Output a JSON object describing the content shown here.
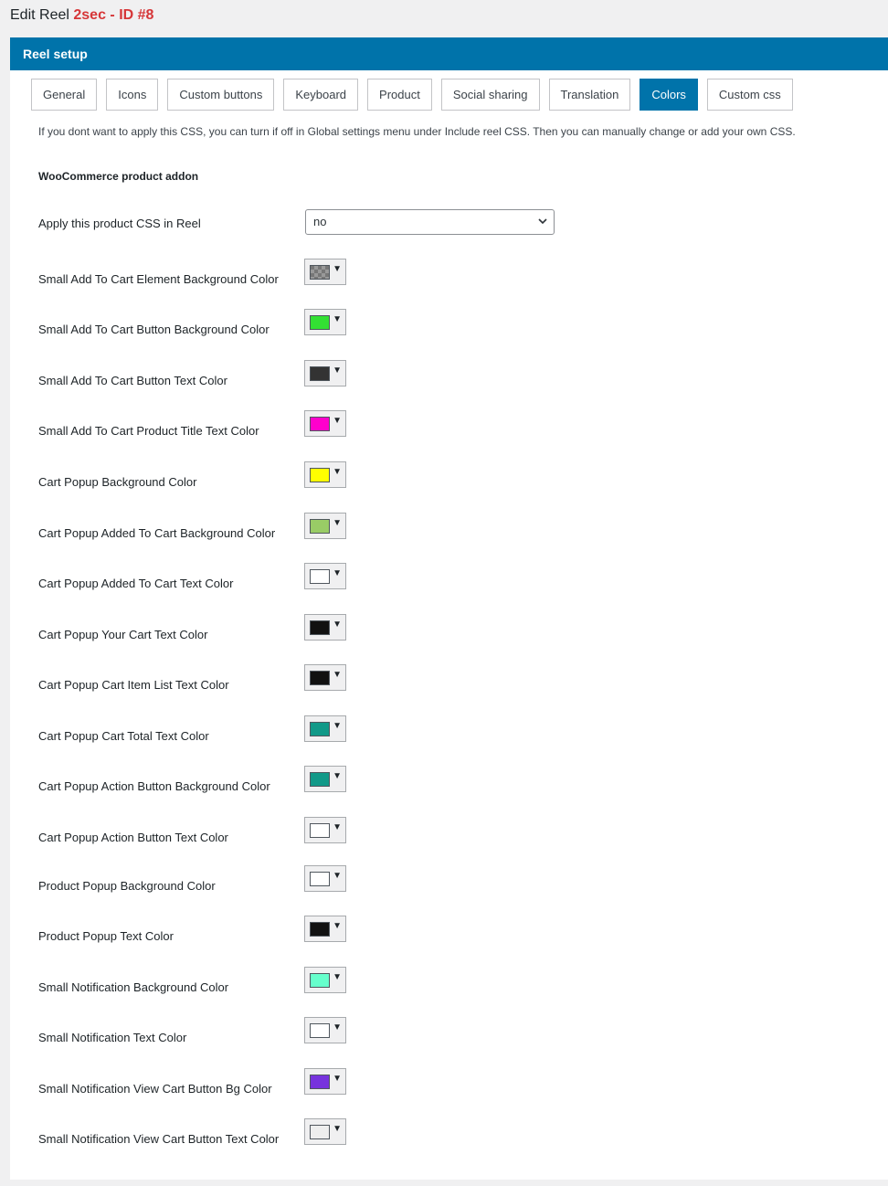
{
  "page": {
    "title_prefix": "Edit Reel",
    "reel_name": "2sec",
    "reel_id": "- ID #8"
  },
  "panel": {
    "header": "Reel setup"
  },
  "tabs": [
    {
      "label": "General",
      "active": false
    },
    {
      "label": "Icons",
      "active": false
    },
    {
      "label": "Custom buttons",
      "active": false
    },
    {
      "label": "Keyboard",
      "active": false
    },
    {
      "label": "Product",
      "active": false
    },
    {
      "label": "Social sharing",
      "active": false
    },
    {
      "label": "Translation",
      "active": false
    },
    {
      "label": "Colors",
      "active": true
    },
    {
      "label": "Custom css",
      "active": false
    }
  ],
  "notice": "If you dont want to apply this CSS, you can turn if off in Global settings menu under Include reel CSS. Then you can manually change or add your own CSS.",
  "section": {
    "title": "WooCommerce product addon"
  },
  "apply_css": {
    "label": "Apply this product CSS in Reel",
    "value": "no"
  },
  "colors": [
    {
      "label": "Small Add To Cart Element Background Color",
      "color": "transparent"
    },
    {
      "label": "Small Add To Cart Button Background Color",
      "color": "#33e033"
    },
    {
      "label": "Small Add To Cart Button Text Color",
      "color": "#333333"
    },
    {
      "label": "Small Add To Cart Product Title Text Color",
      "color": "#ff00cc"
    },
    {
      "label": "Cart Popup Background Color",
      "color": "#ffff00"
    },
    {
      "label": "Cart Popup Added To Cart Background Color",
      "color": "#99cc66"
    },
    {
      "label": "Cart Popup Added To Cart Text Color",
      "color": "#ffffff"
    },
    {
      "label": "Cart Popup Your Cart Text Color",
      "color": "#111111"
    },
    {
      "label": "Cart Popup Cart Item List Text Color",
      "color": "#111111"
    },
    {
      "label": "Cart Popup Cart Total Text Color",
      "color": "#119988"
    },
    {
      "label": "Cart Popup Action Button Background Color",
      "color": "#119988"
    },
    {
      "label": "Cart Popup Action Button Text Color",
      "color": "#ffffff"
    },
    {
      "label": "Product Popup Background Color",
      "color": "#ffffff"
    },
    {
      "label": "Product Popup Text Color",
      "color": "#111111"
    },
    {
      "label": "Small Notification Background Color",
      "color": "#66ffcc"
    },
    {
      "label": "Small Notification Text Color",
      "color": "#ffffff"
    },
    {
      "label": "Small Notification View Cart Button Bg Color",
      "color": "#7733dd"
    },
    {
      "label": "Small Notification View Cart Button Text Color",
      "color": "#eeeeee"
    }
  ],
  "icons": {
    "select_chevron": "chevron-down-icon",
    "picker_arrow": "triangle-down-icon"
  }
}
